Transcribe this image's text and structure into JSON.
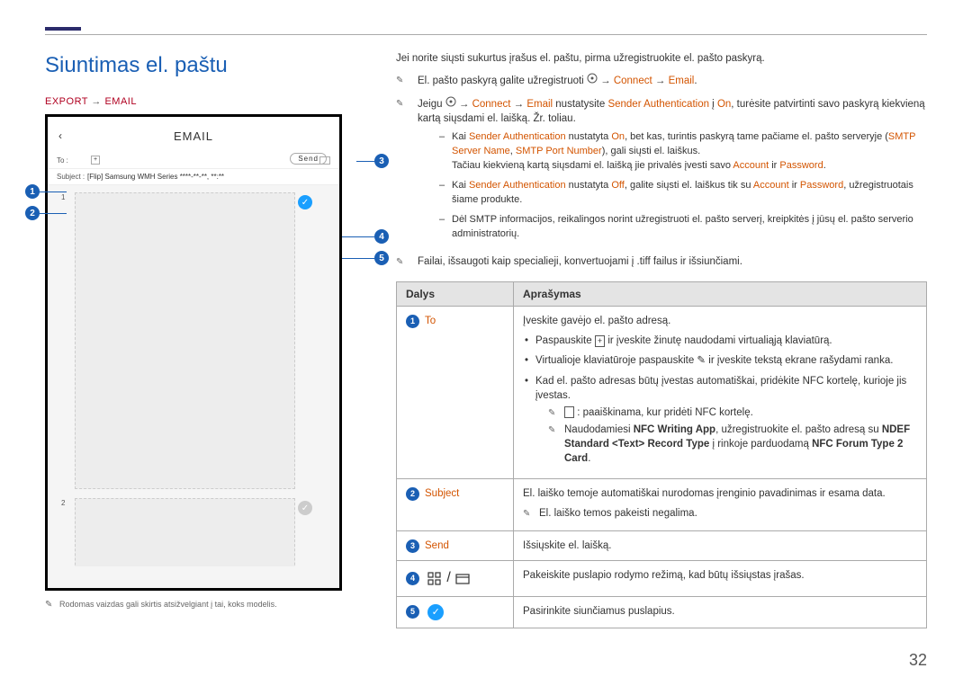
{
  "page_number": "32",
  "title": "Siuntimas el. paštu",
  "breadcrumb": {
    "export": "EXPORT",
    "email": "EMAIL"
  },
  "mock": {
    "title": "EMAIL",
    "send": "Send",
    "to": "To :",
    "subject_label": "Subject :",
    "subject_value": "[Flip] Samsung WMH Series ****-**-**, **:**",
    "thumb1_num": "1",
    "thumb2_num": "2"
  },
  "intro": "Jei norite siųsti sukurtus įrašus el. paštu, pirma užregistruokite el. pašto paskyrą.",
  "notes": {
    "n1_a": "El. pašto paskyrą galite užregistruoti ",
    "n1_b": " → ",
    "n1_c": "Connect",
    "n1_d": " → ",
    "n1_e": "Email",
    "n1_f": ".",
    "n2_a": "Jeigu ",
    "n2_b": " → ",
    "n2_c": "Connect",
    "n2_d": " → ",
    "n2_e": "Email",
    "n2_f": " nustatysite ",
    "n2_g": "Sender Authentication",
    "n2_h": " į ",
    "n2_i": "On",
    "n2_j": ", turėsite patvirtinti savo paskyrą kiekvieną kartą siųsdami el. laišką. Žr. toliau.",
    "sub1_a": "Kai ",
    "sub1_b": "Sender Authentication",
    "sub1_c": " nustatyta ",
    "sub1_d": "On",
    "sub1_e": ", bet kas, turintis paskyrą tame pačiame el. pašto serveryje (",
    "sub1_f": "SMTP Server Name",
    "sub1_g": ", ",
    "sub1_h": "SMTP Port Number",
    "sub1_i": "), gali siųsti el. laiškus.",
    "sub1_j": "Tačiau kiekvieną kartą siųsdami el. laišką jie privalės įvesti savo ",
    "sub1_k": "Account",
    "sub1_l": " ir ",
    "sub1_m": "Password",
    "sub1_n": ".",
    "sub2_a": "Kai ",
    "sub2_b": "Sender Authentication",
    "sub2_c": " nustatyta ",
    "sub2_d": "Off",
    "sub2_e": ", galite siųsti el. laiškus tik su ",
    "sub2_f": "Account",
    "sub2_g": " ir ",
    "sub2_h": "Password",
    "sub2_i": ", užregistruotais šiame produkte.",
    "sub3": "Dėl SMTP informacijos, reikalingos norint užregistruoti el. pašto serverį, kreipkitės į jūsų el. pašto serverio administratorių.",
    "n3": "Failai, išsaugoti kaip specialieji, konvertuojami į .tiff failus ir išsiunčiami."
  },
  "table": {
    "header_parts": "Dalys",
    "header_desc": "Aprašymas",
    "row1_label": "To",
    "row1_intro": "Įveskite gavėjo el. pašto adresą.",
    "row1_b1_a": "Paspauskite ",
    "row1_b1_b": " ir įveskite žinutę naudodami virtualiąją klaviatūrą.",
    "row1_b2_a": "Virtualioje klaviatūroje paspauskite ",
    "row1_b2_b": " ir įveskite tekstą ekrane rašydami ranka.",
    "row1_b3": "Kad el. pašto adresas būtų įvestas automatiškai, pridėkite NFC kortelę, kurioje jis įvestas.",
    "row1_sn1": " : paaiškinama, kur pridėti NFC kortelę.",
    "row1_sn2_a": "Naudodamiesi ",
    "row1_sn2_b": "NFC Writing App",
    "row1_sn2_c": ", užregistruokite el. pašto adresą su ",
    "row1_sn2_d": "NDEF Standard <Text> Record Type",
    "row1_sn2_e": " į rinkoje parduodamą ",
    "row1_sn2_f": "NFC Forum Type 2 Card",
    "row1_sn2_g": ".",
    "row2_label": "Subject",
    "row2_l1": "El. laiško temoje automatiškai nurodomas įrenginio pavadinimas ir esama data.",
    "row2_l2": "El. laiško temos pakeisti negalima.",
    "row3_label": "Send",
    "row3_desc": "Išsiųskite el. laišką.",
    "row4_desc": "Pakeiskite puslapio rodymo režimą, kad būtų išsiųstas įrašas.",
    "row5_desc": "Pasirinkite siunčiamus puslapius."
  },
  "footnote": "Rodomas vaizdas gali skirtis atsižvelgiant į tai, koks modelis."
}
